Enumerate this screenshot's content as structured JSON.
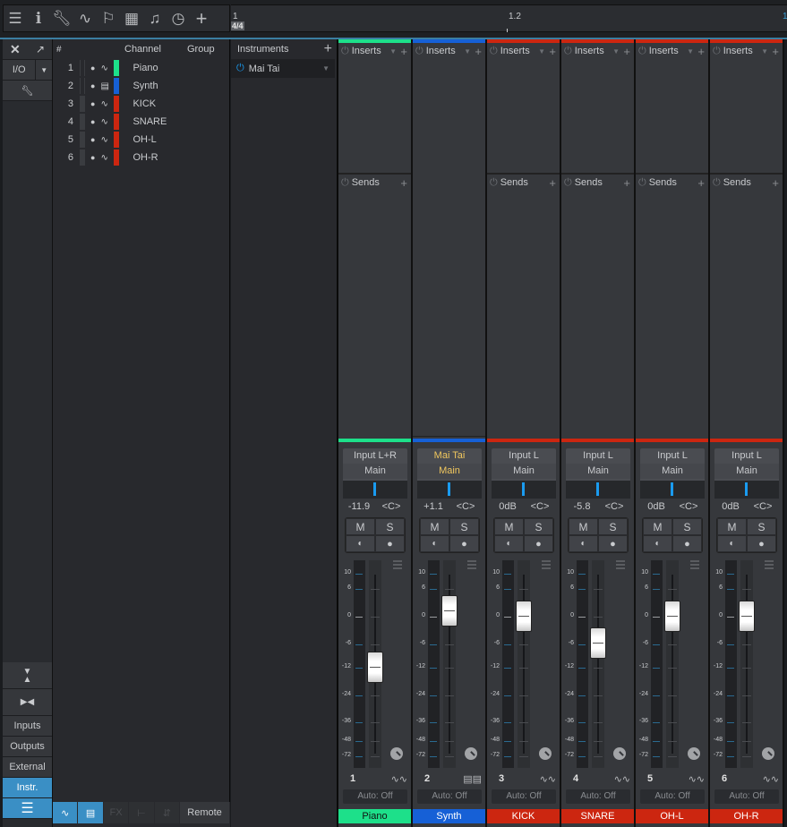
{
  "toolbar": {
    "icons": [
      "menu-icon",
      "info-icon",
      "wrench-icon",
      "automation-curve-icon",
      "marker-flag-icon",
      "grid-icon",
      "score-icon",
      "timer-icon",
      "add-icon"
    ]
  },
  "ruler": {
    "marker_1": "1",
    "marker_2": "1.2",
    "time_signature": "4/4",
    "marker_end": "1"
  },
  "left_panel": {
    "io_label": "I/O",
    "tabs": [
      "Inputs",
      "Outputs",
      "External",
      "Instr."
    ],
    "active_tab": "Instr."
  },
  "channel_list": {
    "headers": {
      "num": "#",
      "channel": "Channel",
      "group": "Group"
    },
    "rows": [
      {
        "num": "1",
        "name": "Piano",
        "color": "#1de08a",
        "icon": "audio-wave-icon"
      },
      {
        "num": "2",
        "name": "Synth",
        "color": "#1660d6",
        "icon": "keyboard-icon"
      },
      {
        "num": "3",
        "name": "KICK",
        "color": "#cc2610",
        "icon": "audio-wave-icon"
      },
      {
        "num": "4",
        "name": "SNARE",
        "color": "#cc2610",
        "icon": "audio-wave-icon"
      },
      {
        "num": "5",
        "name": "OH-L",
        "color": "#cc2610",
        "icon": "audio-wave-icon"
      },
      {
        "num": "6",
        "name": "OH-R",
        "color": "#cc2610",
        "icon": "audio-wave-icon"
      }
    ]
  },
  "instruments": {
    "header": "Instruments",
    "items": [
      {
        "name": "Mai Tai"
      }
    ]
  },
  "bottom": {
    "remote_label": "Remote",
    "fx_label": "FX"
  },
  "mixer": {
    "inserts_label": "Inserts",
    "sends_label": "Sends",
    "scale": [
      "10",
      "6",
      "0",
      "-6",
      "-12",
      "-24",
      "-36",
      "-48",
      "-72"
    ],
    "channels": [
      {
        "num": "1",
        "name": "Piano",
        "color": "#1de08a",
        "input": "Input L+R",
        "output": "Main",
        "volume": "-11.9",
        "volume_db": -11.9,
        "pan": "<C>",
        "auto": "Auto: Off",
        "type": "audio",
        "highlight": false,
        "name_text": "#111"
      },
      {
        "num": "2",
        "name": "Synth",
        "color": "#1660d6",
        "input": "Mai Tai",
        "output": "Main",
        "volume": "+1.1",
        "volume_db": 1.1,
        "pan": "<C>",
        "auto": "Auto: Off",
        "type": "instrument",
        "highlight": true,
        "name_text": "#fff"
      },
      {
        "num": "3",
        "name": "KICK",
        "color": "#cc2610",
        "input": "Input L",
        "output": "Main",
        "volume": "0dB",
        "volume_db": 0,
        "pan": "<C>",
        "auto": "Auto: Off",
        "type": "audio",
        "highlight": false,
        "name_text": "#fff"
      },
      {
        "num": "4",
        "name": "SNARE",
        "color": "#cc2610",
        "input": "Input L",
        "output": "Main",
        "volume": "-5.8",
        "volume_db": -5.8,
        "pan": "<C>",
        "auto": "Auto: Off",
        "type": "audio",
        "highlight": false,
        "name_text": "#fff"
      },
      {
        "num": "5",
        "name": "OH-L",
        "color": "#cc2610",
        "input": "Input L",
        "output": "Main",
        "volume": "0dB",
        "volume_db": 0,
        "pan": "<C>",
        "auto": "Auto: Off",
        "type": "audio",
        "highlight": false,
        "name_text": "#fff"
      },
      {
        "num": "6",
        "name": "OH-R",
        "color": "#cc2610",
        "input": "Input L",
        "output": "Main",
        "volume": "0dB",
        "volume_db": 0,
        "pan": "<C>",
        "auto": "Auto: Off",
        "type": "audio",
        "highlight": false,
        "name_text": "#fff"
      }
    ],
    "mute_label": "M",
    "solo_label": "S"
  }
}
